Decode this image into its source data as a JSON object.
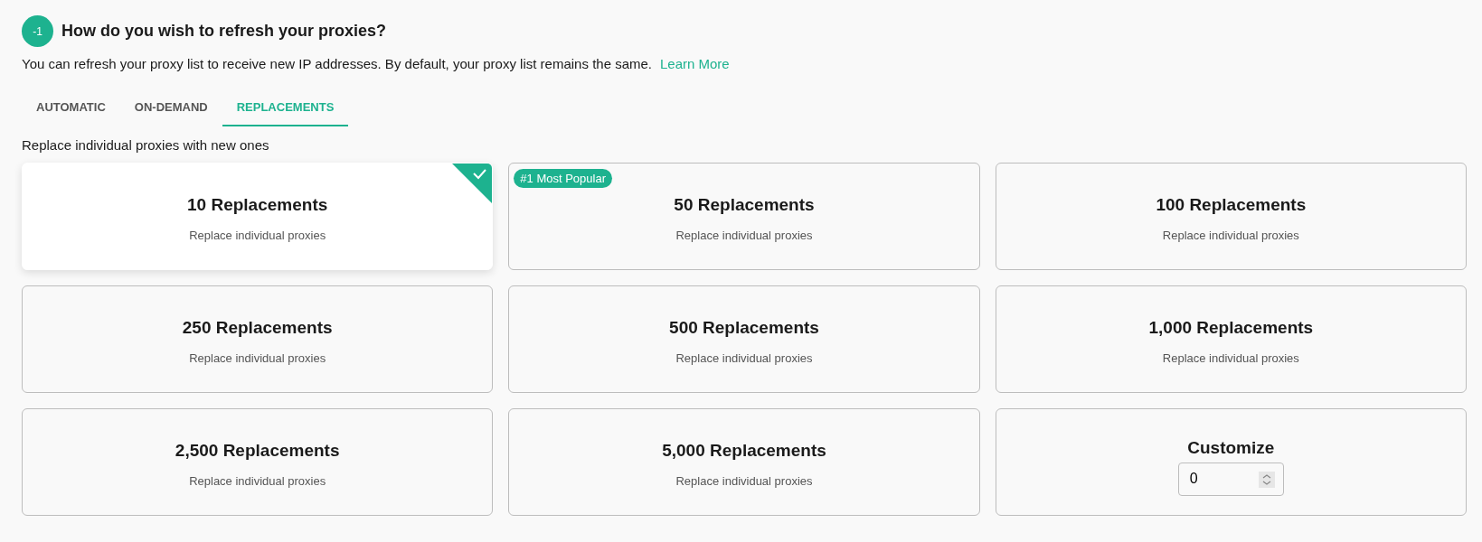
{
  "step_badge": "-1",
  "title": "How do you wish to refresh your proxies?",
  "description": "You can refresh your proxy list to receive new IP addresses. By default, your proxy list remains the same.",
  "learn_more": "Learn More",
  "tabs": [
    {
      "label": "AUTOMATIC",
      "selected": false
    },
    {
      "label": "ON-DEMAND",
      "selected": false
    },
    {
      "label": "REPLACEMENTS",
      "selected": true
    }
  ],
  "section_caption": "Replace individual proxies with new ones",
  "options": [
    {
      "kind": "option",
      "title": "10 Replacements",
      "subtitle": "Replace individual proxies",
      "selected": true
    },
    {
      "kind": "option",
      "title": "50 Replacements",
      "subtitle": "Replace individual proxies",
      "selected": false,
      "badge": "#1 Most Popular"
    },
    {
      "kind": "option",
      "title": "100 Replacements",
      "subtitle": "Replace individual proxies",
      "selected": false
    },
    {
      "kind": "option",
      "title": "250 Replacements",
      "subtitle": "Replace individual proxies",
      "selected": false
    },
    {
      "kind": "option",
      "title": "500 Replacements",
      "subtitle": "Replace individual proxies",
      "selected": false
    },
    {
      "kind": "option",
      "title": "1,000 Replacements",
      "subtitle": "Replace individual proxies",
      "selected": false
    },
    {
      "kind": "option",
      "title": "2,500 Replacements",
      "subtitle": "Replace individual proxies",
      "selected": false
    },
    {
      "kind": "option",
      "title": "5,000 Replacements",
      "subtitle": "Replace individual proxies",
      "selected": false
    },
    {
      "kind": "custom",
      "title": "Customize",
      "value": "0",
      "selected": false
    }
  ]
}
